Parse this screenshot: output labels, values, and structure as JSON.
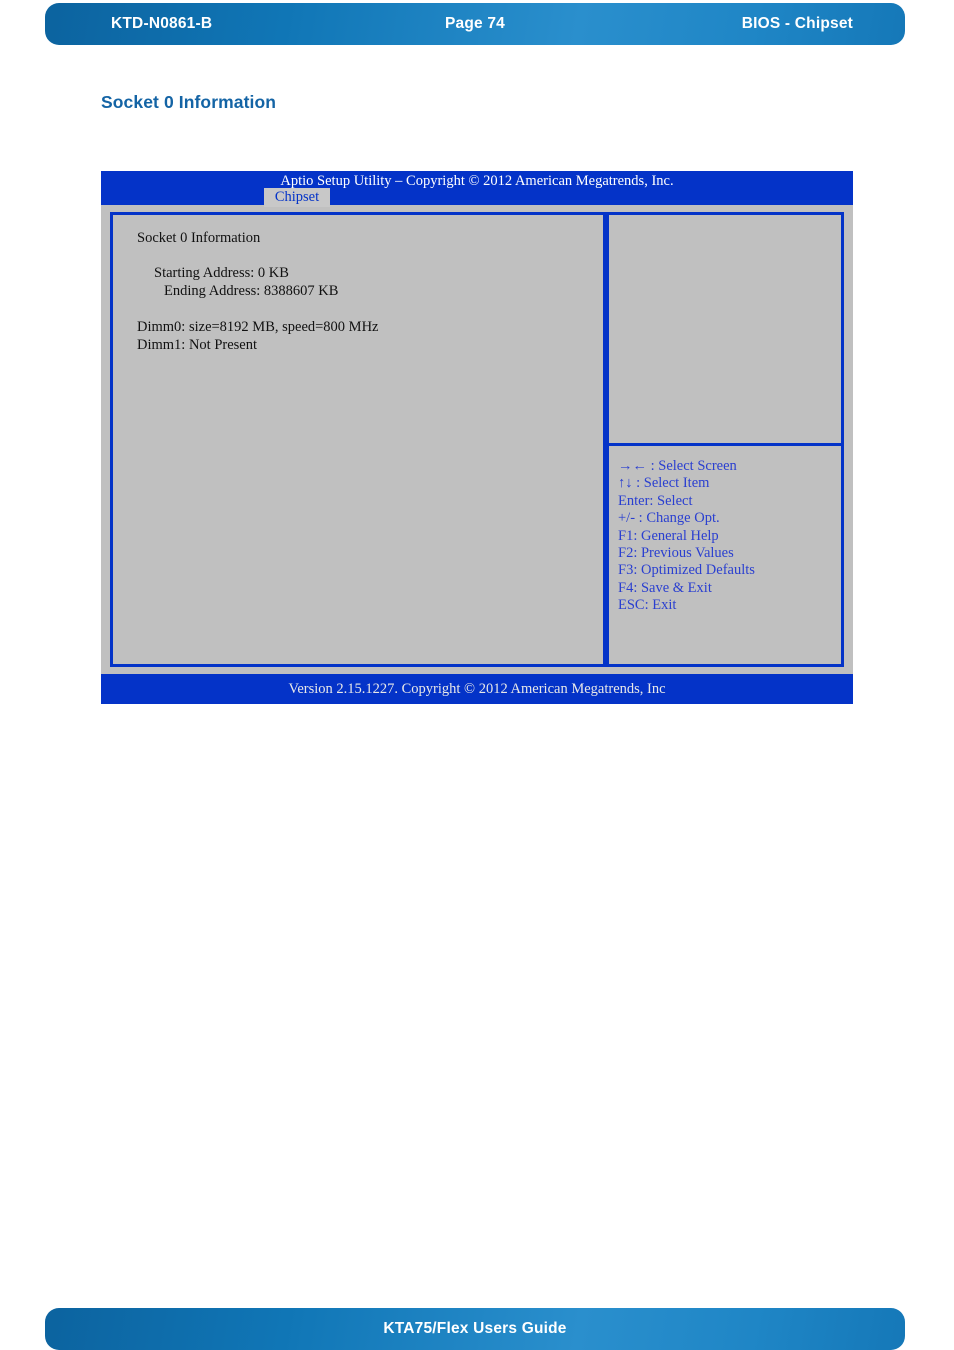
{
  "page": {
    "header": {
      "doc_id": "KTD-N0861-B",
      "page_label": "Page 74",
      "section": "BIOS  - Chipset"
    },
    "footer": {
      "guide_title": "KTA75/Flex Users Guide"
    },
    "heading": "Socket 0 Information",
    "colors": {
      "banner_blue": "#1076b6",
      "heading_blue": "#1464a5",
      "bios_blue": "#0433c8",
      "bios_gray": "#c0c0c0",
      "help_text_blue": "#2a3fd0"
    }
  },
  "bios": {
    "title": "Aptio Setup Utility  –  Copyright © 2012 American Megatrends, Inc.",
    "active_tab": "Chipset",
    "tabs": [
      "Chipset"
    ],
    "main": {
      "section_title": "Socket 0 Information",
      "fields": [
        {
          "label": "Starting Address:",
          "value": "0 KB"
        },
        {
          "label": "Ending Address:",
          "value": "8388607 KB"
        }
      ],
      "starting_address_line": "Starting Address:  0 KB",
      "ending_address_line": "Ending Address: 8388607 KB",
      "dimm0_line": "Dimm0: size=8192 MB, speed=800 MHz",
      "dimm1_line": "Dimm1: Not Present"
    },
    "help": {
      "description": "",
      "keys": [
        "→← : Select Screen",
        "↑↓ : Select Item",
        "Enter: Select",
        "+/- : Change Opt.",
        "F1: General Help",
        "F2: Previous Values",
        "F3: Optimized Defaults",
        "F4: Save & Exit",
        "ESC: Exit"
      ]
    },
    "version_bar": "Version 2.15.1227. Copyright © 2012 American Megatrends, Inc"
  }
}
